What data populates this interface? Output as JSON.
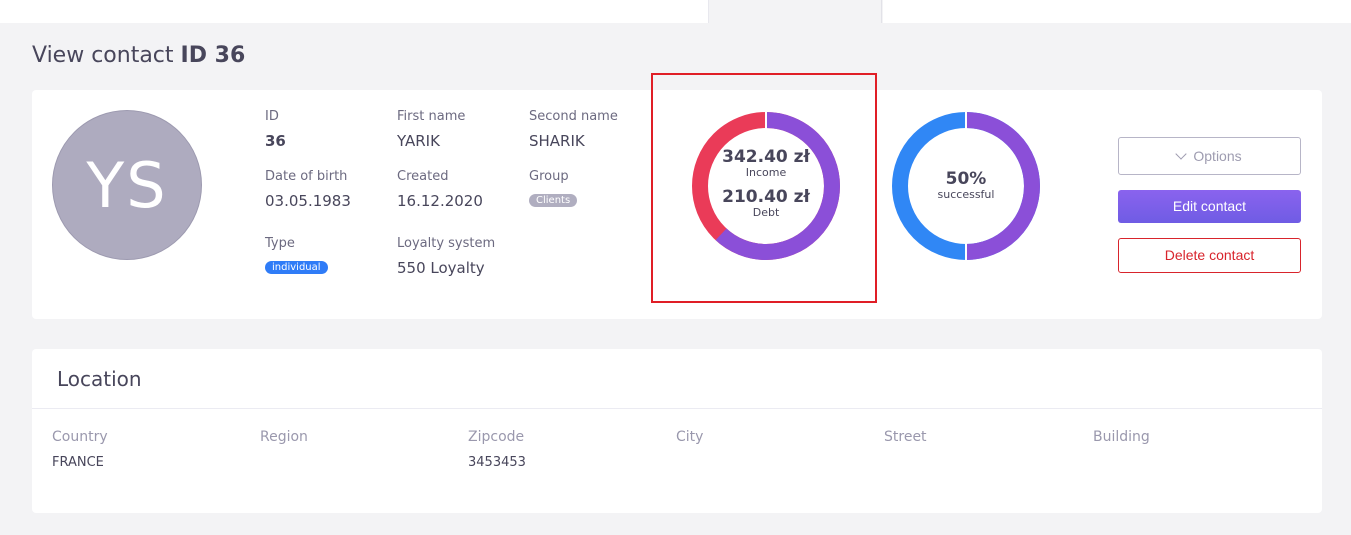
{
  "header": {
    "title_prefix": "View contact",
    "title_id": "ID 36"
  },
  "contact": {
    "avatar_initials": "YS",
    "fields": {
      "id": {
        "label": "ID",
        "value": "36"
      },
      "first_name": {
        "label": "First name",
        "value": "YARIK"
      },
      "second_name": {
        "label": "Second name",
        "value": "SHARIK"
      },
      "dob": {
        "label": "Date of birth",
        "value": "03.05.1983"
      },
      "created": {
        "label": "Created",
        "value": "16.12.2020"
      },
      "group": {
        "label": "Group",
        "value": "Clients"
      },
      "type": {
        "label": "Type",
        "value": "individual"
      },
      "loyalty": {
        "label": "Loyalty system",
        "value": "550 Loyalty"
      }
    }
  },
  "finance_chart": {
    "income_amount": "342.40 zł",
    "income_label": "Income",
    "debt_amount": "210.40 zł",
    "debt_label": "Debt",
    "income_fraction": 0.619,
    "debt_fraction": 0.381,
    "income_color": "#8b4fd8",
    "debt_color": "#ea3b58"
  },
  "success_chart": {
    "percent_label": "50%",
    "caption": "successful",
    "fraction": 0.5,
    "color_a": "#8b4fd8",
    "color_b": "#3087f5"
  },
  "actions": {
    "options_label": "Options",
    "edit_label": "Edit contact",
    "delete_label": "Delete contact"
  },
  "location": {
    "title": "Location",
    "columns": [
      {
        "label": "Country",
        "value": "FRANCE"
      },
      {
        "label": "Region",
        "value": ""
      },
      {
        "label": "Zipcode",
        "value": "3453453"
      },
      {
        "label": "City",
        "value": ""
      },
      {
        "label": "Street",
        "value": ""
      },
      {
        "label": "Building",
        "value": ""
      }
    ]
  },
  "colors": {
    "primary_gradient_start": "#8a63ee",
    "danger": "#d8242c",
    "badge_blue": "#2f7cf7",
    "highlight_box": "#e01e26"
  }
}
